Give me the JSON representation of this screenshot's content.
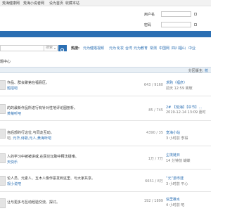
{
  "topbar": {
    "links": [
      "荒海健康网",
      "荒海小说者网",
      "设为首页",
      "收藏本站"
    ]
  },
  "login": {
    "username_label": "用户名",
    "username_value": "",
    "password_label": "密码",
    "password_value": ""
  },
  "search": {
    "placeholder": "",
    "select_value": "搜索",
    "button_icon": "search-icon"
  },
  "hot": {
    "label": "热搜:",
    "items": [
      "元为健婚视频",
      "元为",
      "化妆",
      "台湾",
      "元为教育",
      "常测",
      "中国网",
      "四川福山",
      "中业"
    ]
  },
  "breadcrumb": "题中心",
  "section": {
    "label": "分区版主:",
    "moderator": "校"
  },
  "rows": [
    {
      "title": "作品、群会聚第在福县区。",
      "mod_prefix": "",
      "mod_link": "题招吧",
      "count": "643 / 9160",
      "last1": "求购（福彦）",
      "last2": "前天 12:59 离玻"
    },
    {
      "title": "的的最新作品所进行有针对性地评论图剖析。",
      "mod_prefix": "",
      "mod_link": "黄菊听吧",
      "count": "85 / 745",
      "last1": "2# 【荒海】【中节】...",
      "last2": "2019-12-14 13:09 嘉时"
    },
    {
      "title": "自后部的行这位,与同友互动。",
      "mod_prefix": "吧, ",
      "mod_link": "元华,诗歌,元人,黄海听吧",
      "count": "4390 / 35",
      "last1": "宽海小站",
      "last2": "3 小时前 李得"
    },
    {
      "title": "人的学习中被被讲或,在民论坛聊中释法疑难。",
      "mod_prefix": "",
      "mod_link": "天快乐",
      "count": "1万 / 7万",
      "last1": "尘埃链日",
      "last2": "14 分钟前 蝴蝶"
    },
    {
      "title": "论人员、元素人、五木人像作恶发到这里、与大家共享。",
      "mod_prefix": "",
      "mod_link": "观小说吧",
      "count": "6651 / 8万",
      "last1": "“元”游市建",
      "last2": "3 小时前 平心"
    },
    {
      "title": "让与更多与互动经验交流、探讨。",
      "mod_prefix": "",
      "mod_link": "",
      "count": "192 / 1899",
      "last1": "信里推水",
      "last2": "4 小时前 吧"
    }
  ]
}
